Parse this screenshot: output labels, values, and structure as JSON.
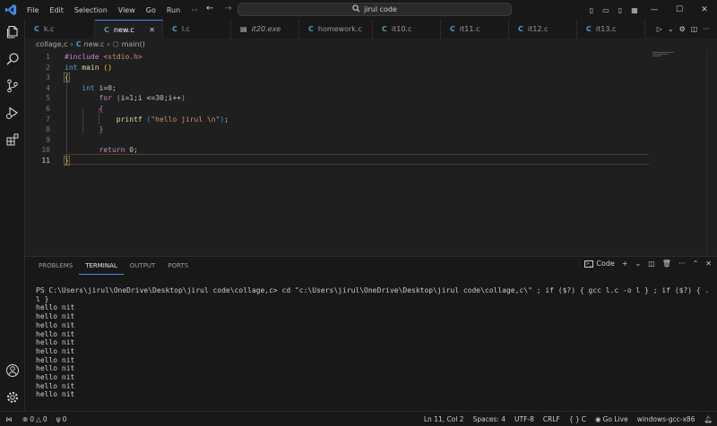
{
  "window": {
    "title": "jirul code",
    "menu": [
      "File",
      "Edit",
      "Selection",
      "View",
      "Go",
      "Run"
    ],
    "more_menu": "···"
  },
  "tabs": [
    {
      "label": "k.c",
      "icon": "c-file-icon",
      "active": false
    },
    {
      "label": "new.c",
      "icon": "c-file-icon",
      "active": true
    },
    {
      "label": "l.c",
      "icon": "c-file-icon",
      "active": false
    },
    {
      "label": "it20.exe",
      "icon": "exe-file-icon",
      "active": false
    },
    {
      "label": "homework.c",
      "icon": "c-file-icon",
      "active": false
    },
    {
      "label": "it10.c",
      "icon": "c-file-icon",
      "active": false
    },
    {
      "label": "it11.c",
      "icon": "c-file-icon",
      "active": false
    },
    {
      "label": "it12.c",
      "icon": "c-file-icon",
      "active": false
    },
    {
      "label": "it13.c",
      "icon": "c-file-icon",
      "active": false
    }
  ],
  "breadcrumb": {
    "folder": "collage,c",
    "file": "new.c",
    "symbol": "main()"
  },
  "editor": {
    "line_numbers": [
      "1",
      "2",
      "3",
      "4",
      "5",
      "6",
      "7",
      "8",
      "9",
      "10",
      "11"
    ],
    "current_line": "11"
  },
  "panel": {
    "tabs": [
      "PROBLEMS",
      "TERMINAL",
      "OUTPUT",
      "PORTS"
    ],
    "active_tab": "TERMINAL",
    "terminal_profile": "Code",
    "terminal_command": "PS C:\\Users\\jirul\\OneDrive\\Desktop\\jirul code\\collage,c> cd \"c:\\Users\\jirul\\OneDrive\\Desktop\\jirul code\\collage,c\\\" ; if ($?) { gcc l.c -o l } ; if ($?) { .\\",
    "terminal_command_cont": "l }",
    "terminal_output": [
      "hello nit",
      "hello nit",
      "hello nit",
      "hello nit",
      "hello nit",
      "hello nit",
      "hello nit",
      "hello nit",
      "hello nit",
      "hello nit",
      "hello nit"
    ]
  },
  "statusbar": {
    "errors": "0",
    "warnings": "0",
    "ports": "0",
    "position": "Ln 11, Col 2",
    "spaces": "Spaces: 4",
    "encoding": "UTF-8",
    "eol": "CRLF",
    "language": "C",
    "go_live": "Go Live",
    "config": "windows-gcc-x86"
  },
  "colors": {
    "accent": "#3b8eea",
    "keyword": "#569cd6",
    "control": "#c586c0",
    "string": "#ce9178",
    "number": "#b5cea8",
    "function": "#dcdcaa"
  }
}
